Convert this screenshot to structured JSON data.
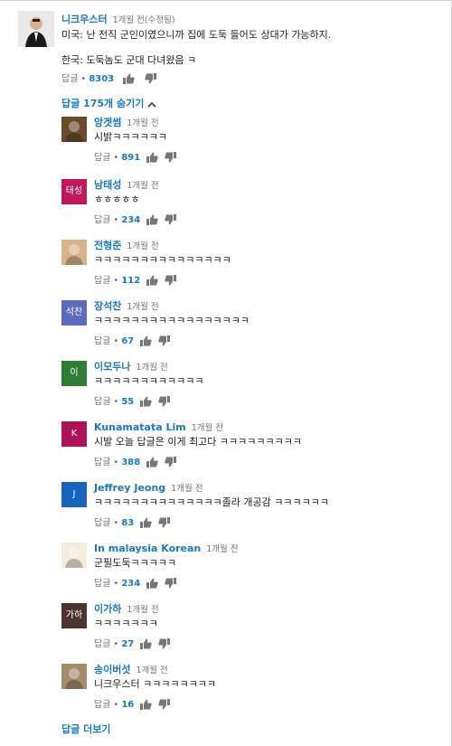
{
  "top_comment": {
    "author": "니크우스터",
    "time": "1개월 전(수정됨)",
    "line1": "미국: 난 전직 군인이였으니까 집에 도둑 들어도 상대가 가능하지.",
    "line2": "한국: 도둑놈도 군대 다녀왔음 ㅋ",
    "reply_label": "답글",
    "likes": "8303",
    "hide_replies": "답글 175개 숨기기"
  },
  "replies": [
    {
      "author": "앙겟썸",
      "time": "1개월 전",
      "text": "시밝ㅋㅋㅋㅋㅋㅋ",
      "likes": "891",
      "avatar_text": "",
      "avatar_color": "#6b4a2a"
    },
    {
      "author": "남태성",
      "time": "1개월 전",
      "text": "ㅎㅎㅎㅎㅎ",
      "likes": "234",
      "avatar_text": "태성",
      "avatar_color": "#c2185b"
    },
    {
      "author": "전형준",
      "time": "1개월 전",
      "text": "ㅋㅋㅋㅋㅋㅋㅋㅋㅋㅋㅋㅋㅋㅋㅋ",
      "likes": "112",
      "avatar_text": "",
      "avatar_color": "#d9b48a"
    },
    {
      "author": "장석찬",
      "time": "1개월 전",
      "text": "ㅋㅋㅋㅋㅋㅋㅋㅋㅋㅋㅋㅋㅋㅋㅋㅋㅋ",
      "likes": "67",
      "avatar_text": "석찬",
      "avatar_color": "#5c6bc0"
    },
    {
      "author": "이모두나",
      "time": "1개월 전",
      "text": "ㅋㅋㅋㅋㅋㅋㅋㅋㅋㅋㅋㅋ",
      "likes": "55",
      "avatar_text": "이",
      "avatar_color": "#2e7d32"
    },
    {
      "author": "Kunamatata Lim",
      "time": "1개월 전",
      "text": "시발 오늘 답글은 이게 최고다 ㅋㅋㅋㅋㅋㅋㅋㅋㅋ",
      "likes": "388",
      "avatar_text": "K",
      "avatar_color": "#ad1457"
    },
    {
      "author": "Jeffrey Jeong",
      "time": "1개월 전",
      "text": "ㅋㅋㅋㅋㅋㅋㅋㅋㅋㅋㅋㅋㅋㅋ졸라 개공감 ㅋㅋㅋㅋㅋㅋ",
      "likes": "83",
      "avatar_text": "J",
      "avatar_color": "#1565c0"
    },
    {
      "author": "In malaysia Korean",
      "time": "1개월 전",
      "text": "군필도둑ㅋㅋㅋㅋㅋ",
      "likes": "234",
      "avatar_text": "",
      "avatar_color": "#f5ece0"
    },
    {
      "author": "이가하",
      "time": "1개월 전",
      "text": "ㅋㅋㅋㅋㅋㅋㅋ",
      "likes": "27",
      "avatar_text": "가하",
      "avatar_color": "#4e342e"
    },
    {
      "author": "송이버섯",
      "time": "1개월 전",
      "text": "니크우스터 ㅋㅋㅋㅋㅋㅋㅋㅋ",
      "likes": "16",
      "avatar_text": "",
      "avatar_color": "#a58b6a"
    }
  ],
  "reply_label": "답글",
  "show_more": "답글 더보기",
  "colors": {
    "link": "#167ac6",
    "muted": "#767676"
  }
}
